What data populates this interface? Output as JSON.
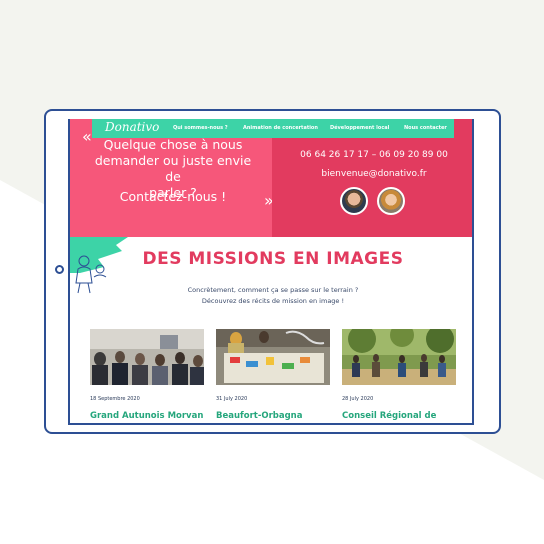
{
  "site": {
    "logo": "Donativo",
    "nav": [
      {
        "label": "Qui sommes-nous ?"
      },
      {
        "label": "Animation de concertation"
      },
      {
        "label": "Développement local"
      },
      {
        "label": "Nous contacter"
      }
    ]
  },
  "hero": {
    "quote_open": "«",
    "quote_close": "»",
    "question_line1": "Quelque chose à nous",
    "question_line2": "demander ou juste envie de",
    "question_line3": "parler ?",
    "cta": "Contactez-nous !",
    "phones": "06 64 26 17 17  –  06 09 20 89 00",
    "email": "bienvenue@donativo.fr"
  },
  "missions": {
    "title": "DES MISSIONS EN IMAGES",
    "intro_line1": "Concrètement, comment ça se passe sur le terrain ?",
    "intro_line2": "Découvrez des récits de mission en image !",
    "cards": [
      {
        "date": "18 Septembre 2020",
        "title": "Grand Autunois Morvan"
      },
      {
        "date": "31 July 2020",
        "title": "Beaufort-Orbagna"
      },
      {
        "date": "28 July 2020",
        "title": "Conseil Régional de"
      }
    ]
  },
  "colors": {
    "accent_pink": "#e23b5f",
    "accent_pink_light": "#f6577a",
    "accent_teal": "#3dd3a7",
    "title_green": "#25a67c",
    "frame_blue": "#2d4f94"
  }
}
